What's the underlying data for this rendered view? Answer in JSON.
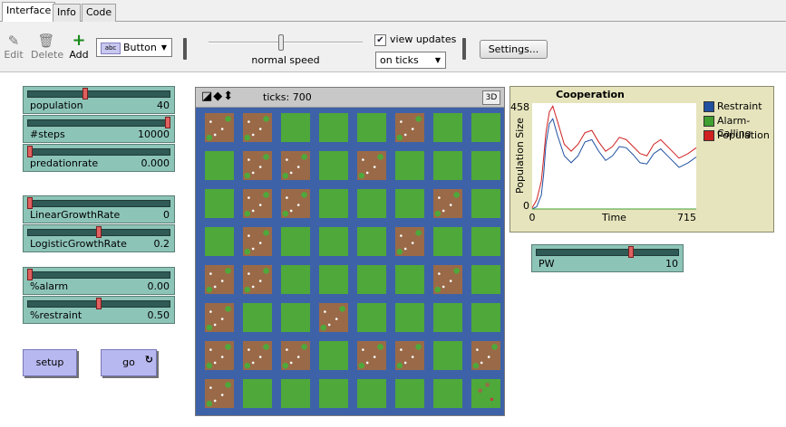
{
  "tabs": [
    {
      "label": "Interface",
      "active": true
    },
    {
      "label": "Info",
      "active": false
    },
    {
      "label": "Code",
      "active": false
    }
  ],
  "toolbar": {
    "edit_label": "Edit",
    "delete_label": "Delete",
    "add_label": "Add",
    "widget_type": "Button",
    "widget_badge": "abc",
    "speed_label": "normal speed",
    "speed_fraction": 0.47,
    "view_updates_label": "view updates",
    "view_updates_checked": true,
    "update_mode": "on ticks",
    "settings_label": "Settings..."
  },
  "sliders": [
    {
      "name": "population",
      "value": "40",
      "fraction": 0.4
    },
    {
      "name": "#steps",
      "value": "10000",
      "fraction": 1.0
    },
    {
      "name": "predationrate",
      "value": "0.000",
      "fraction": 0.0
    },
    {
      "name": "LinearGrowthRate",
      "value": "0",
      "fraction": 0.0
    },
    {
      "name": "LogisticGrowthRate",
      "value": "0.2",
      "fraction": 0.5
    },
    {
      "name": "%alarm",
      "value": "0.00",
      "fraction": 0.0
    },
    {
      "name": "%restraint",
      "value": "0.50",
      "fraction": 0.5
    },
    {
      "name": "PW",
      "value": "10",
      "fraction": 0.67
    }
  ],
  "buttons": {
    "setup": "setup",
    "go": "go",
    "go_forever_icon": "forever-icon"
  },
  "view": {
    "ticks_label": "ticks: 700",
    "three_d_label": "3D",
    "grid_size": 8
  },
  "chart_data": {
    "type": "line",
    "title": "Cooperation",
    "xlabel": "Time",
    "ylabel": "Population Size",
    "xlim": [
      0,
      715
    ],
    "ylim": [
      0,
      458
    ],
    "x_tick_labels": [
      "0",
      "715"
    ],
    "y_tick_labels": [
      "0",
      "458"
    ],
    "series": [
      {
        "name": "Restraint",
        "color": "#2050a0",
        "x": [
          0,
          20,
          40,
          50,
          60,
          75,
          90,
          110,
          140,
          170,
          200,
          230,
          260,
          290,
          320,
          350,
          380,
          410,
          440,
          470,
          500,
          530,
          560,
          600,
          640,
          680,
          715
        ],
        "y": [
          0,
          10,
          60,
          150,
          280,
          370,
          390,
          320,
          230,
          200,
          230,
          290,
          300,
          250,
          210,
          230,
          270,
          265,
          235,
          200,
          195,
          240,
          260,
          220,
          180,
          200,
          225
        ]
      },
      {
        "name": "Alarm-Calling",
        "color": "#40a030",
        "x": [
          0,
          715
        ],
        "y": [
          0,
          0
        ]
      },
      {
        "name": "Population",
        "color": "#d02020",
        "x": [
          0,
          20,
          40,
          50,
          60,
          75,
          90,
          110,
          140,
          170,
          200,
          230,
          260,
          290,
          320,
          350,
          380,
          410,
          440,
          470,
          500,
          530,
          560,
          600,
          640,
          680,
          715
        ],
        "y": [
          5,
          40,
          120,
          220,
          330,
          420,
          445,
          380,
          280,
          250,
          280,
          330,
          340,
          290,
          250,
          270,
          310,
          300,
          270,
          240,
          230,
          280,
          300,
          260,
          220,
          240,
          265
        ]
      }
    ]
  }
}
